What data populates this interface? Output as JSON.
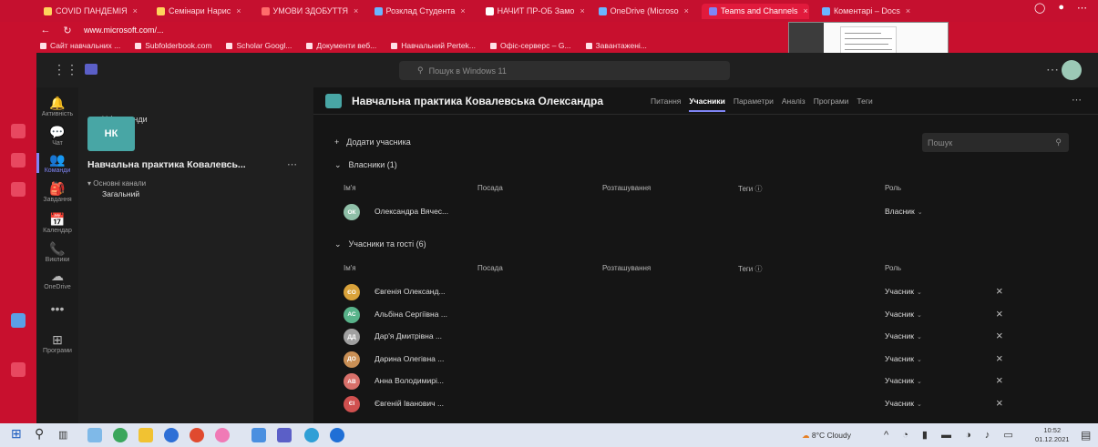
{
  "browser": {
    "tabs": [
      {
        "label": "COVID ПАНДЕМІЯ",
        "color": "#ffd35c"
      },
      {
        "label": "Семінари Нарис",
        "color": "#ffd35c"
      },
      {
        "label": "УМОВИ ЗДОБУТТЯ",
        "color": "#ff6b6b"
      },
      {
        "label": "Розклад Студента",
        "color": "#6bb5ff"
      },
      {
        "label": "НАЧИТ ПР-ОБ Замо",
        "color": "#ffffff"
      },
      {
        "label": "OneDrive (Microso",
        "color": "#6bb5ff"
      },
      {
        "label": "Teams and Channels",
        "color": "#7f85f5",
        "active": true
      },
      {
        "label": "Коментарі – Docs",
        "color": "#6bb5ff"
      }
    ],
    "url": "www.microsoft.com/...",
    "bookmarks": [
      "Сайт навчальних ...",
      "Subfolderbook.com",
      "Scholar Googl...",
      "Документи веб...",
      "Навчальний Pertek...",
      "Офіс-серверс – G...",
      "Завантажені..."
    ]
  },
  "teams": {
    "search_placeholder": "Пошук в Windows 11",
    "rail": [
      {
        "label": "Активність",
        "icon": "bell-icon",
        "glyph": "🔔"
      },
      {
        "label": "Чат",
        "icon": "chat-icon",
        "glyph": "💬"
      },
      {
        "label": "Команди",
        "icon": "teams-icon",
        "glyph": "👥",
        "active": true
      },
      {
        "label": "Завдання",
        "icon": "assignments-icon",
        "glyph": "🎒"
      },
      {
        "label": "Календар",
        "icon": "calendar-icon",
        "glyph": "📅"
      },
      {
        "label": "Виклики",
        "icon": "phone-icon",
        "glyph": "📞"
      },
      {
        "label": "OneDrive",
        "icon": "cloud-icon",
        "glyph": "☁"
      },
      {
        "label": "",
        "icon": "more-apps-icon",
        "glyph": "•••"
      },
      {
        "label": "Програми",
        "icon": "apps-icon",
        "glyph": "⊞"
      }
    ],
    "side": {
      "back_label": "Усі команди",
      "team_initials": "НК",
      "team_name": "Навчальна практика Ковалевсь...",
      "channel_group": "Основні канали",
      "channel": "Загальний"
    },
    "channel": {
      "title": "Навчальна практика Ковалевська Олександра",
      "tabs": [
        "Питання",
        "Учасники",
        "Параметри",
        "Аналіз",
        "Програми",
        "Теги"
      ],
      "active_tab": "Учасники"
    },
    "members": {
      "add_label": "Додати учасника",
      "search_placeholder": "Пошук",
      "owners_section": "Власники (1)",
      "guests_section": "Учасники та гості (6)",
      "columns": [
        "Ім'я",
        "Посада",
        "Розташування",
        "Теги",
        "Роль"
      ],
      "owners": [
        {
          "initials": "ОК",
          "name": "Олександра Вячес...",
          "role": "Власник",
          "avatar_color": "#8fbfa8"
        }
      ],
      "guests": [
        {
          "initials": "ЄО",
          "name": "Євгенія Олександ...",
          "role": "Учасник",
          "avatar_color": "#d9a23a"
        },
        {
          "initials": "АС",
          "name": "Альбіна Сергіївна ...",
          "role": "Учасник",
          "avatar_color": "#58b38a"
        },
        {
          "initials": "ДД",
          "name": "Дар'я Дмитрівна ...",
          "role": "Учасник",
          "avatar_color": "#a0a0a0"
        },
        {
          "initials": "ДО",
          "name": "Дарина Олегівна ...",
          "role": "Учасник",
          "avatar_color": "#c98f55"
        },
        {
          "initials": "АВ",
          "name": "Анна Володимирі...",
          "role": "Учасник",
          "avatar_color": "#d8706a"
        },
        {
          "initials": "ЄІ",
          "name": "Євгеній Іванович ...",
          "role": "Учасник",
          "avatar_color": "#d0504f"
        }
      ]
    }
  },
  "taskbar": {
    "weather": "8°C Cloudy",
    "time": "10:52",
    "date": "01.12.2021"
  }
}
